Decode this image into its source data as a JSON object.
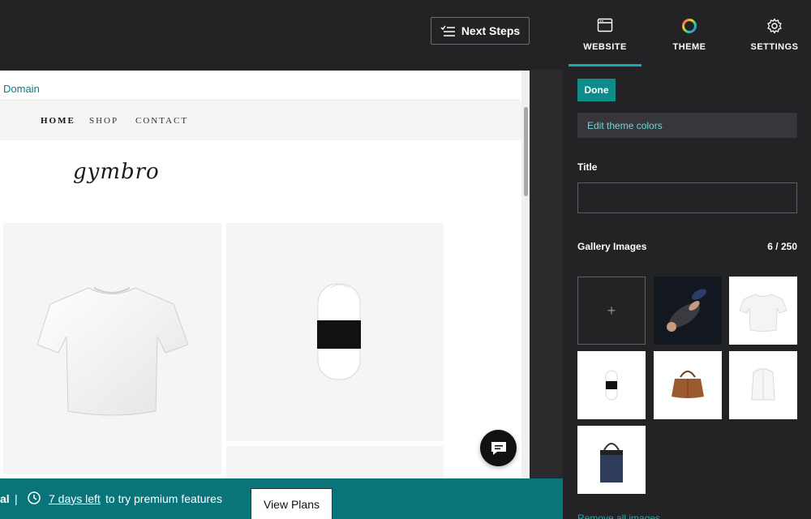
{
  "toolbar": {
    "next_steps_label": "Next Steps"
  },
  "preview": {
    "domain_link": "Domain",
    "nav": {
      "home": "HOME",
      "shop": "SHOP",
      "contact": "CONTACT"
    },
    "logo_text": "gymbro"
  },
  "trial_bar": {
    "prefix": "al",
    "separator": "|",
    "days_left": "7 days left",
    "rest": "to try premium features",
    "view_plans_label": "View Plans"
  },
  "panel": {
    "tabs": [
      {
        "label": "WEBSITE",
        "icon": "browser-window-icon",
        "active": true
      },
      {
        "label": "THEME",
        "icon": "color-wheel-icon",
        "active": false
      },
      {
        "label": "SETTINGS",
        "icon": "gear-icon",
        "active": false
      }
    ],
    "done_label": "Done",
    "edit_theme_colors_label": "Edit theme colors",
    "title_label": "Title",
    "title_value": "",
    "gallery_label": "Gallery Images",
    "gallery_count": "6 / 250",
    "add_image_symbol": "+",
    "remove_all_label": "Remove all images"
  },
  "colors": {
    "accent": "#0e8b8b",
    "trial_bar": "#09757a",
    "panel_bg": "#232326",
    "link": "#6fd6d6"
  }
}
